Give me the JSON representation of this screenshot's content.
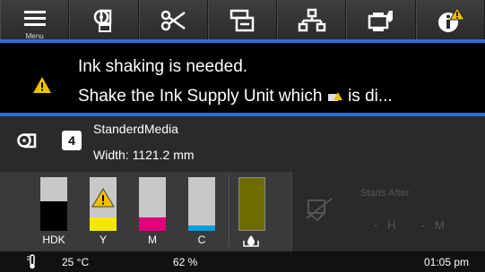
{
  "toolbar": {
    "menu_label": "Menu",
    "buttons": [
      "menu-icon",
      "media-settings-icon",
      "cut-icon",
      "copy-icon",
      "network-icon",
      "maintenance-icon",
      "info-warning-icon"
    ]
  },
  "notification": {
    "line1": "Ink shaking is needed.",
    "line2_before": "Shake the Ink Supply Unit which",
    "line2_after": "is di...",
    "accent": "#2e6fd6",
    "warning_color": "#f0c000"
  },
  "media": {
    "number": "4",
    "name": "StanderdMedia",
    "width": "Width: 1121.2 mm"
  },
  "ink": {
    "units": [
      {
        "label": "HDK",
        "color": "#000000",
        "level": 0.55,
        "strip": null,
        "warning": false
      },
      {
        "label": "Y",
        "color": "#f5e800",
        "level": 0.25,
        "strip": null,
        "warning": true
      },
      {
        "label": "M",
        "color": "#e0007a",
        "level": 0.25,
        "strip": null,
        "warning": false
      },
      {
        "label": "C",
        "color": "#c8c8c8",
        "level": 0.1,
        "strip": "#00a0e0",
        "warning": false
      }
    ],
    "maintenance_color": "#6e6c00"
  },
  "starts_after": {
    "label": "Starts After",
    "hours_dash": "-",
    "hours_unit": "H",
    "minutes_dash": "-",
    "minutes_unit": "M"
  },
  "status": {
    "temperature": "25 °C",
    "humidity": "62 %",
    "time": "01:05 pm"
  }
}
